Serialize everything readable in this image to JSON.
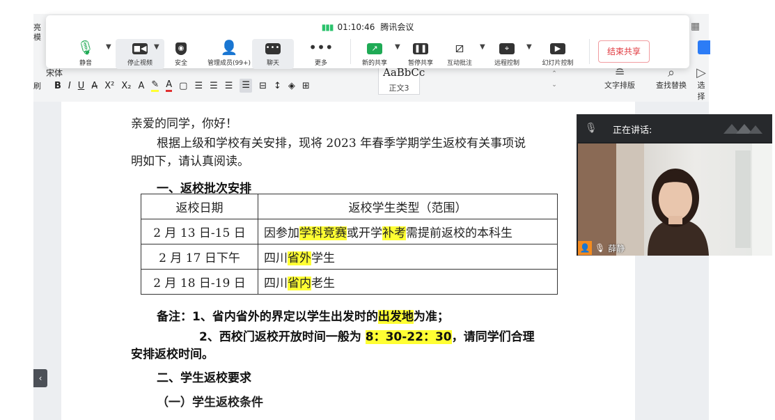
{
  "meeting": {
    "duration": "01:10:46",
    "app_title": "腾讯会议",
    "buttons": {
      "mute": "静音",
      "stop_video": "停止视频",
      "security": "安全",
      "manage_members": "管理成员(99+)",
      "chat": "聊天",
      "more": "更多",
      "new_share": "新的共享",
      "pause_share": "暂停共享",
      "annotate": "互动批注",
      "remote_control": "远程控制",
      "slideshow_control": "幻灯片控制",
      "end_share": "结束共享"
    },
    "accent_color": "#1faa55",
    "end_color": "#e0383e"
  },
  "ribbon": {
    "edge_left": "亮模",
    "edge_brush": "刷",
    "font_name": "宋体",
    "style_sample": "AaBbCc",
    "style_name": "正文3",
    "text_layout": "文字排版",
    "find_replace": "查找替换",
    "select": "选择"
  },
  "document": {
    "greeting": "亲爱的同学，你好！",
    "intro_line1": "根据上级和学校有关安排，现将 2023 年春季学期学生返校有关事项说",
    "intro_line2": "明如下，请认真阅读。",
    "section1": "一、返校批次安排",
    "table": {
      "headers": [
        "返校日期",
        "返校学生类型（范围）"
      ],
      "rows": [
        {
          "date": "2 月 13 日-15 日",
          "p1": "因参加",
          "h1": "学科竞赛",
          "p2": "或开学",
          "h2": "补考",
          "p3": "需提前返校的本科生"
        },
        {
          "date": "2 月 17 日下午",
          "p1": "四川",
          "h1": "省外",
          "p2": "学生"
        },
        {
          "date": "2 月 18 日-19 日",
          "p1": "四川",
          "h1": "省内",
          "p2": "老生"
        }
      ]
    },
    "note1_pre": "备注：1、省内省外的界定以学生出发时的",
    "note1_hl": "出发地",
    "note1_post": "为准；",
    "note2_pre": "2、西校门返校开放时间一般为 ",
    "note2_hl": "8：30-22：30",
    "note2_post": "，请同学们合理",
    "note2_line2": "安排返校时间。",
    "section2": "二、学生返校要求",
    "subsection1": "（一）学生返校条件",
    "highlight_color": "#ffff33"
  },
  "video": {
    "speaking_label": "正在讲话:",
    "speaker_name": "薛静"
  }
}
